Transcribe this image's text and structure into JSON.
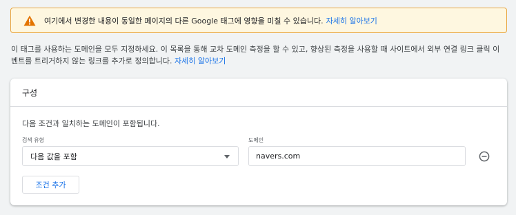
{
  "warning": {
    "icon": "warning-icon",
    "text": "여기에서 변경한 내용이 동일한 페이지의 다른 Google 태그에 영향을 미칠 수 있습니다.",
    "link": "자세히 알아보기"
  },
  "description": {
    "text": "이 태그를 사용하는 도메인을 모두 지정하세요. 이 목록을 통해 교차 도메인 측정을 할 수 있고, 향상된 측정을 사용할 때 사이트에서 외부 연결 링크 클릭 이벤트를 트리거하지 않는 링크를 추가로 정의합니다.",
    "link": "자세히 알아보기"
  },
  "config": {
    "title": "구성",
    "intro": "다음 조건과 일치하는 도메인이 포함됩니다.",
    "match_type_label": "검색 유형",
    "match_type_value": "다음 값을 포함",
    "domain_label": "도메인",
    "domain_value": "navers.com",
    "remove_icon": "remove-circle-icon",
    "add_condition": "조건 추가"
  },
  "colors": {
    "accent": "#1a73e8",
    "warning_border": "#e8a53e",
    "warning_icon": "#e37400",
    "warning_bg": "#fef7e0"
  }
}
